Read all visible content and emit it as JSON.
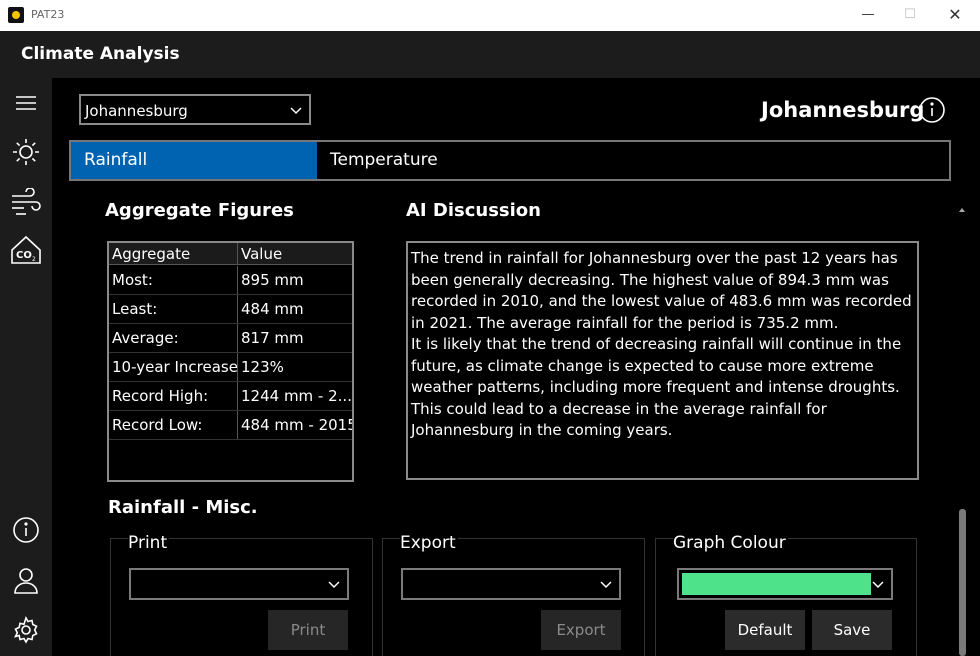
{
  "window": {
    "title": "PAT23"
  },
  "header": {
    "title": "Climate Analysis"
  },
  "city_selector": {
    "selected": "Johannesburg"
  },
  "city_heading": "Johannesburg",
  "tabs": [
    {
      "label": "Rainfall",
      "active": true
    },
    {
      "label": "Temperature",
      "active": false
    }
  ],
  "aggregate": {
    "heading": "Aggregate Figures",
    "columns": [
      "Aggregate",
      "Value"
    ],
    "rows": [
      [
        "Most:",
        "895 mm"
      ],
      [
        "Least:",
        "484 mm"
      ],
      [
        "Average:",
        "817 mm"
      ],
      [
        "10-year Increase:",
        "123%"
      ],
      [
        "Record High:",
        "1244 mm - 2..."
      ],
      [
        "Record Low:",
        "484 mm - 2015"
      ]
    ]
  },
  "ai": {
    "heading": "AI Discussion",
    "paragraph1": "The trend in rainfall for Johannesburg over the past 12 years has been generally decreasing. The highest value of 894.3 mm was recorded in 2010, and the lowest value of 483.6 mm was recorded in 2021. The average rainfall for the period is 735.2 mm.",
    "paragraph2": "It is likely that the trend of decreasing rainfall will continue in the future, as climate change is expected to cause more extreme weather patterns, including more frequent and intense droughts. This could lead to a decrease in the average rainfall for Johannesburg in the coming years."
  },
  "misc": {
    "heading": "Rainfall - Misc.",
    "print": {
      "title": "Print",
      "button": "Print"
    },
    "export": {
      "title": "Export",
      "button": "Export"
    },
    "graph_colour": {
      "title": "Graph Colour",
      "swatch": "#4ee38a",
      "default_button": "Default",
      "save_button": "Save"
    }
  },
  "colors": {
    "accent": "#0063b1",
    "background": "#000000",
    "chrome": "#1c1c1c"
  },
  "icons": [
    "hamburger-icon",
    "sun-icon",
    "wind-icon",
    "co2-icon",
    "info-icon",
    "user-icon",
    "settings-icon"
  ]
}
